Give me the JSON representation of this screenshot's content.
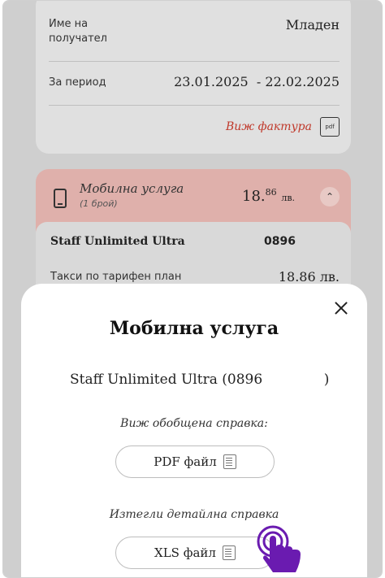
{
  "invoice": {
    "recipient_label": "Име на получател",
    "recipient_value": "Младен",
    "period_label": "За период",
    "period_value": "23.01.2025  - 22.02.2025",
    "view_invoice": "Виж фактура",
    "pdf_icon_text": "pdf"
  },
  "mobile_service": {
    "title": "Мобилна услуга",
    "count": "(1 брой)",
    "price_main": "18.",
    "price_cents": "86",
    "price_unit": "лв.",
    "plan_name": "Staff Unlimited Ultra",
    "number": "0896",
    "tax_label": "Такси по тарифен план",
    "tax_value": "18.86 лв."
  },
  "sheet": {
    "title": "Мобилна услуга",
    "service_line": "Staff Unlimited Ultra (0896              )",
    "summary_label": "Виж обобщена справка:",
    "pdf_button": "PDF файл",
    "detail_label": "Изтегли детайлна справка",
    "xls_button": "XLS файл"
  },
  "colors": {
    "accent": "#c0392b",
    "mobile_card": "#dfb0ab",
    "hand_cursor": "#6a1bb0"
  }
}
